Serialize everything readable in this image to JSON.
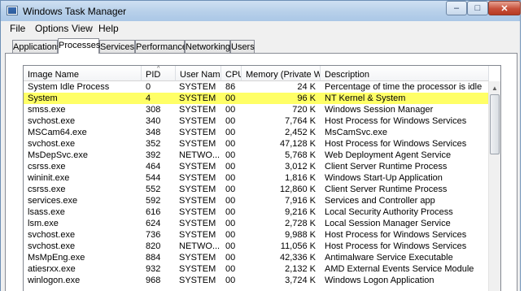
{
  "window": {
    "title": "Windows Task Manager",
    "minimize_glyph": "–",
    "maximize_glyph": "□",
    "close_glyph": "✕"
  },
  "menu": [
    "File",
    "Options",
    "View",
    "Help"
  ],
  "tabs": [
    "Applications",
    "Processes",
    "Services",
    "Performance",
    "Networking",
    "Users"
  ],
  "active_tab": "Processes",
  "columns": [
    "Image Name",
    "PID",
    "User Name",
    "CPU",
    "Memory (Private W...",
    "Description"
  ],
  "sort_indicator": "^",
  "highlight_color": "#ffff66",
  "processes": [
    {
      "name": "System Idle Process",
      "pid": "0",
      "user": "SYSTEM",
      "cpu": "86",
      "mem": "24 K",
      "desc": "Percentage of time the processor is idle"
    },
    {
      "name": "System",
      "pid": "4",
      "user": "SYSTEM",
      "cpu": "00",
      "mem": "96 K",
      "desc": "NT Kernel & System"
    },
    {
      "name": "smss.exe",
      "pid": "308",
      "user": "SYSTEM",
      "cpu": "00",
      "mem": "720 K",
      "desc": "Windows Session Manager"
    },
    {
      "name": "svchost.exe",
      "pid": "340",
      "user": "SYSTEM",
      "cpu": "00",
      "mem": "7,764 K",
      "desc": "Host Process for Windows Services"
    },
    {
      "name": "MSCam64.exe",
      "pid": "348",
      "user": "SYSTEM",
      "cpu": "00",
      "mem": "2,452 K",
      "desc": "MsCamSvc.exe"
    },
    {
      "name": "svchost.exe",
      "pid": "352",
      "user": "SYSTEM",
      "cpu": "00",
      "mem": "47,128 K",
      "desc": "Host Process for Windows Services"
    },
    {
      "name": "MsDepSvc.exe",
      "pid": "392",
      "user": "NETWO...",
      "cpu": "00",
      "mem": "5,768 K",
      "desc": "Web Deployment Agent Service"
    },
    {
      "name": "csrss.exe",
      "pid": "464",
      "user": "SYSTEM",
      "cpu": "00",
      "mem": "3,012 K",
      "desc": "Client Server Runtime Process"
    },
    {
      "name": "wininit.exe",
      "pid": "544",
      "user": "SYSTEM",
      "cpu": "00",
      "mem": "1,816 K",
      "desc": "Windows Start-Up Application"
    },
    {
      "name": "csrss.exe",
      "pid": "552",
      "user": "SYSTEM",
      "cpu": "00",
      "mem": "12,860 K",
      "desc": "Client Server Runtime Process"
    },
    {
      "name": "services.exe",
      "pid": "592",
      "user": "SYSTEM",
      "cpu": "00",
      "mem": "7,916 K",
      "desc": "Services and Controller app"
    },
    {
      "name": "lsass.exe",
      "pid": "616",
      "user": "SYSTEM",
      "cpu": "00",
      "mem": "9,216 K",
      "desc": "Local Security Authority Process"
    },
    {
      "name": "lsm.exe",
      "pid": "624",
      "user": "SYSTEM",
      "cpu": "00",
      "mem": "2,728 K",
      "desc": "Local Session Manager Service"
    },
    {
      "name": "svchost.exe",
      "pid": "736",
      "user": "SYSTEM",
      "cpu": "00",
      "mem": "9,988 K",
      "desc": "Host Process for Windows Services"
    },
    {
      "name": "svchost.exe",
      "pid": "820",
      "user": "NETWO...",
      "cpu": "00",
      "mem": "11,056 K",
      "desc": "Host Process for Windows Services"
    },
    {
      "name": "MsMpEng.exe",
      "pid": "884",
      "user": "SYSTEM",
      "cpu": "00",
      "mem": "42,336 K",
      "desc": "Antimalware Service Executable"
    },
    {
      "name": "atiesrxx.exe",
      "pid": "932",
      "user": "SYSTEM",
      "cpu": "00",
      "mem": "2,132 K",
      "desc": "AMD External Events Service Module"
    },
    {
      "name": "winlogon.exe",
      "pid": "968",
      "user": "SYSTEM",
      "cpu": "00",
      "mem": "3,724 K",
      "desc": "Windows Logon Application"
    }
  ],
  "highlighted_row": 1,
  "icons": {
    "app": "task-manager-icon",
    "sort": "sort-ascending-icon",
    "scroll_up": "scroll-up-arrow-icon"
  }
}
